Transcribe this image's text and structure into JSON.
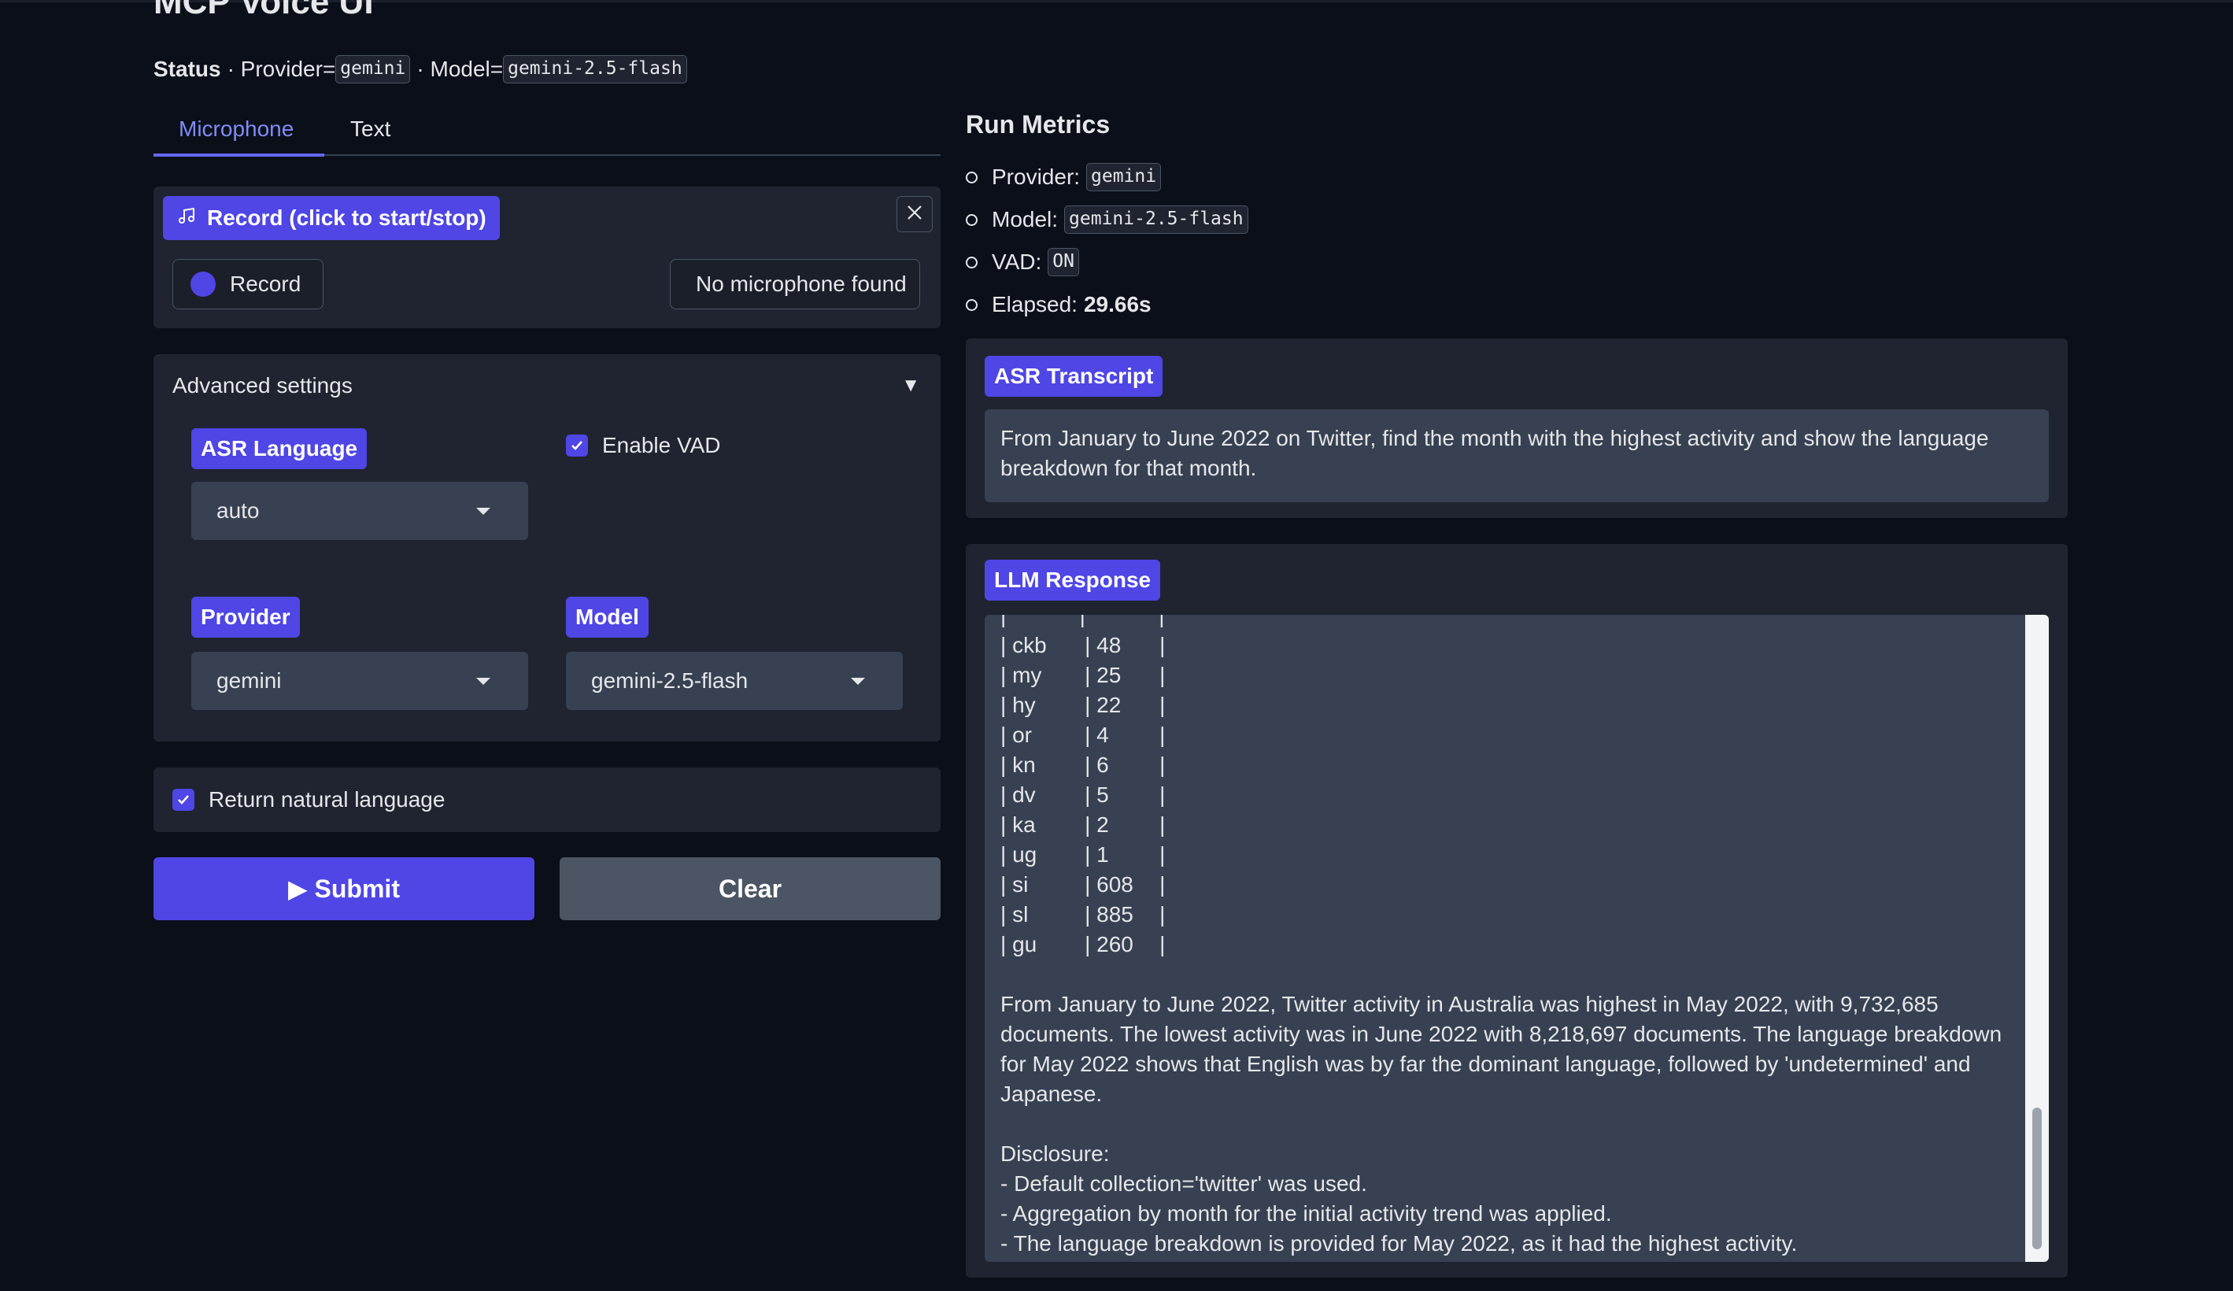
{
  "app": {
    "title": "MCP Voice UI"
  },
  "status": {
    "label": "Status",
    "provider_prefix": "· Provider=",
    "provider": "gemini",
    "model_prefix": "· Model=",
    "model": "gemini-2.5-flash"
  },
  "tabs": [
    {
      "label": "Microphone",
      "active": true
    },
    {
      "label": "Text",
      "active": false
    }
  ],
  "record": {
    "label": "Record (click to start/stop)",
    "button_label": "Record",
    "mic_device": "No microphone found"
  },
  "advanced": {
    "title": "Advanced settings",
    "asr_language": {
      "label": "ASR Language",
      "value": "auto"
    },
    "enable_vad": {
      "label": "Enable VAD",
      "checked": true
    },
    "provider": {
      "label": "Provider",
      "value": "gemini"
    },
    "model": {
      "label": "Model",
      "value": "gemini-2.5-flash"
    }
  },
  "return_nl": {
    "label": "Return natural language",
    "checked": true
  },
  "actions": {
    "submit_label": "▶ Submit",
    "clear_label": "Clear"
  },
  "metrics": {
    "title": "Run Metrics",
    "provider_label": "Provider:",
    "provider": "gemini",
    "model_label": "Model:",
    "model": "gemini-2.5-flash",
    "vad_label": "VAD:",
    "vad": "ON",
    "elapsed_label": "Elapsed:",
    "elapsed": "29.66s"
  },
  "asr": {
    "label": "ASR Transcript",
    "text": "From January to June 2022 on Twitter, find the month with the highest activity and show the language breakdown for that month."
  },
  "llm": {
    "label": "LLM Response",
    "table_rows": [
      {
        "lang": "ckb",
        "count": "48"
      },
      {
        "lang": "my",
        "count": "25"
      },
      {
        "lang": "hy",
        "count": "22"
      },
      {
        "lang": "or",
        "count": "4"
      },
      {
        "lang": "kn",
        "count": "6"
      },
      {
        "lang": "dv",
        "count": "5"
      },
      {
        "lang": "ka",
        "count": "2"
      },
      {
        "lang": "ug",
        "count": "1"
      },
      {
        "lang": "si",
        "count": "608"
      },
      {
        "lang": "sl",
        "count": "885"
      },
      {
        "lang": "gu",
        "count": "260"
      }
    ],
    "summary": "From January to June 2022, Twitter activity in Australia was highest in May 2022, with 9,732,685 documents. The lowest activity was in June 2022 with 8,218,697 documents. The language breakdown for May 2022 shows that English was by far the dominant language, followed by 'undetermined' and Japanese.",
    "disclosure_title": "Disclosure:",
    "disclosures": [
      "- Default collection='twitter' was used.",
      "- Aggregation by month for the initial activity trend was applied.",
      "- The language breakdown is provided for May 2022, as it had the highest activity."
    ]
  }
}
